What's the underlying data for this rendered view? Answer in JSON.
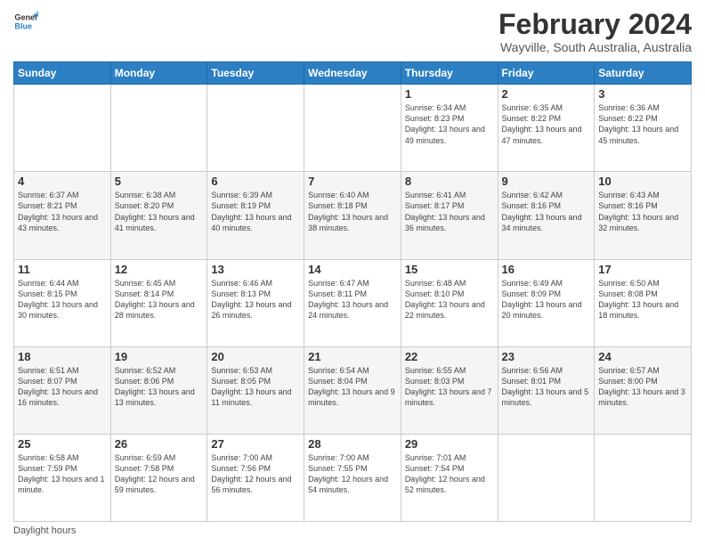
{
  "logo": {
    "line1": "General",
    "line2": "Blue"
  },
  "title": "February 2024",
  "subtitle": "Wayville, South Australia, Australia",
  "days_header": [
    "Sunday",
    "Monday",
    "Tuesday",
    "Wednesday",
    "Thursday",
    "Friday",
    "Saturday"
  ],
  "weeks": [
    [
      {
        "day": "",
        "sunrise": "",
        "sunset": "",
        "daylight": ""
      },
      {
        "day": "",
        "sunrise": "",
        "sunset": "",
        "daylight": ""
      },
      {
        "day": "",
        "sunrise": "",
        "sunset": "",
        "daylight": ""
      },
      {
        "day": "",
        "sunrise": "",
        "sunset": "",
        "daylight": ""
      },
      {
        "day": "1",
        "sunrise": "Sunrise: 6:34 AM",
        "sunset": "Sunset: 8:23 PM",
        "daylight": "Daylight: 13 hours and 49 minutes."
      },
      {
        "day": "2",
        "sunrise": "Sunrise: 6:35 AM",
        "sunset": "Sunset: 8:22 PM",
        "daylight": "Daylight: 13 hours and 47 minutes."
      },
      {
        "day": "3",
        "sunrise": "Sunrise: 6:36 AM",
        "sunset": "Sunset: 8:22 PM",
        "daylight": "Daylight: 13 hours and 45 minutes."
      }
    ],
    [
      {
        "day": "4",
        "sunrise": "Sunrise: 6:37 AM",
        "sunset": "Sunset: 8:21 PM",
        "daylight": "Daylight: 13 hours and 43 minutes."
      },
      {
        "day": "5",
        "sunrise": "Sunrise: 6:38 AM",
        "sunset": "Sunset: 8:20 PM",
        "daylight": "Daylight: 13 hours and 41 minutes."
      },
      {
        "day": "6",
        "sunrise": "Sunrise: 6:39 AM",
        "sunset": "Sunset: 8:19 PM",
        "daylight": "Daylight: 13 hours and 40 minutes."
      },
      {
        "day": "7",
        "sunrise": "Sunrise: 6:40 AM",
        "sunset": "Sunset: 8:18 PM",
        "daylight": "Daylight: 13 hours and 38 minutes."
      },
      {
        "day": "8",
        "sunrise": "Sunrise: 6:41 AM",
        "sunset": "Sunset: 8:17 PM",
        "daylight": "Daylight: 13 hours and 36 minutes."
      },
      {
        "day": "9",
        "sunrise": "Sunrise: 6:42 AM",
        "sunset": "Sunset: 8:16 PM",
        "daylight": "Daylight: 13 hours and 34 minutes."
      },
      {
        "day": "10",
        "sunrise": "Sunrise: 6:43 AM",
        "sunset": "Sunset: 8:16 PM",
        "daylight": "Daylight: 13 hours and 32 minutes."
      }
    ],
    [
      {
        "day": "11",
        "sunrise": "Sunrise: 6:44 AM",
        "sunset": "Sunset: 8:15 PM",
        "daylight": "Daylight: 13 hours and 30 minutes."
      },
      {
        "day": "12",
        "sunrise": "Sunrise: 6:45 AM",
        "sunset": "Sunset: 8:14 PM",
        "daylight": "Daylight: 13 hours and 28 minutes."
      },
      {
        "day": "13",
        "sunrise": "Sunrise: 6:46 AM",
        "sunset": "Sunset: 8:13 PM",
        "daylight": "Daylight: 13 hours and 26 minutes."
      },
      {
        "day": "14",
        "sunrise": "Sunrise: 6:47 AM",
        "sunset": "Sunset: 8:11 PM",
        "daylight": "Daylight: 13 hours and 24 minutes."
      },
      {
        "day": "15",
        "sunrise": "Sunrise: 6:48 AM",
        "sunset": "Sunset: 8:10 PM",
        "daylight": "Daylight: 13 hours and 22 minutes."
      },
      {
        "day": "16",
        "sunrise": "Sunrise: 6:49 AM",
        "sunset": "Sunset: 8:09 PM",
        "daylight": "Daylight: 13 hours and 20 minutes."
      },
      {
        "day": "17",
        "sunrise": "Sunrise: 6:50 AM",
        "sunset": "Sunset: 8:08 PM",
        "daylight": "Daylight: 13 hours and 18 minutes."
      }
    ],
    [
      {
        "day": "18",
        "sunrise": "Sunrise: 6:51 AM",
        "sunset": "Sunset: 8:07 PM",
        "daylight": "Daylight: 13 hours and 16 minutes."
      },
      {
        "day": "19",
        "sunrise": "Sunrise: 6:52 AM",
        "sunset": "Sunset: 8:06 PM",
        "daylight": "Daylight: 13 hours and 13 minutes."
      },
      {
        "day": "20",
        "sunrise": "Sunrise: 6:53 AM",
        "sunset": "Sunset: 8:05 PM",
        "daylight": "Daylight: 13 hours and 11 minutes."
      },
      {
        "day": "21",
        "sunrise": "Sunrise: 6:54 AM",
        "sunset": "Sunset: 8:04 PM",
        "daylight": "Daylight: 13 hours and 9 minutes."
      },
      {
        "day": "22",
        "sunrise": "Sunrise: 6:55 AM",
        "sunset": "Sunset: 8:03 PM",
        "daylight": "Daylight: 13 hours and 7 minutes."
      },
      {
        "day": "23",
        "sunrise": "Sunrise: 6:56 AM",
        "sunset": "Sunset: 8:01 PM",
        "daylight": "Daylight: 13 hours and 5 minutes."
      },
      {
        "day": "24",
        "sunrise": "Sunrise: 6:57 AM",
        "sunset": "Sunset: 8:00 PM",
        "daylight": "Daylight: 13 hours and 3 minutes."
      }
    ],
    [
      {
        "day": "25",
        "sunrise": "Sunrise: 6:58 AM",
        "sunset": "Sunset: 7:59 PM",
        "daylight": "Daylight: 13 hours and 1 minute."
      },
      {
        "day": "26",
        "sunrise": "Sunrise: 6:59 AM",
        "sunset": "Sunset: 7:58 PM",
        "daylight": "Daylight: 12 hours and 59 minutes."
      },
      {
        "day": "27",
        "sunrise": "Sunrise: 7:00 AM",
        "sunset": "Sunset: 7:56 PM",
        "daylight": "Daylight: 12 hours and 56 minutes."
      },
      {
        "day": "28",
        "sunrise": "Sunrise: 7:00 AM",
        "sunset": "Sunset: 7:55 PM",
        "daylight": "Daylight: 12 hours and 54 minutes."
      },
      {
        "day": "29",
        "sunrise": "Sunrise: 7:01 AM",
        "sunset": "Sunset: 7:54 PM",
        "daylight": "Daylight: 12 hours and 52 minutes."
      },
      {
        "day": "",
        "sunrise": "",
        "sunset": "",
        "daylight": ""
      },
      {
        "day": "",
        "sunrise": "",
        "sunset": "",
        "daylight": ""
      }
    ]
  ],
  "footer": {
    "label": "Daylight hours"
  }
}
